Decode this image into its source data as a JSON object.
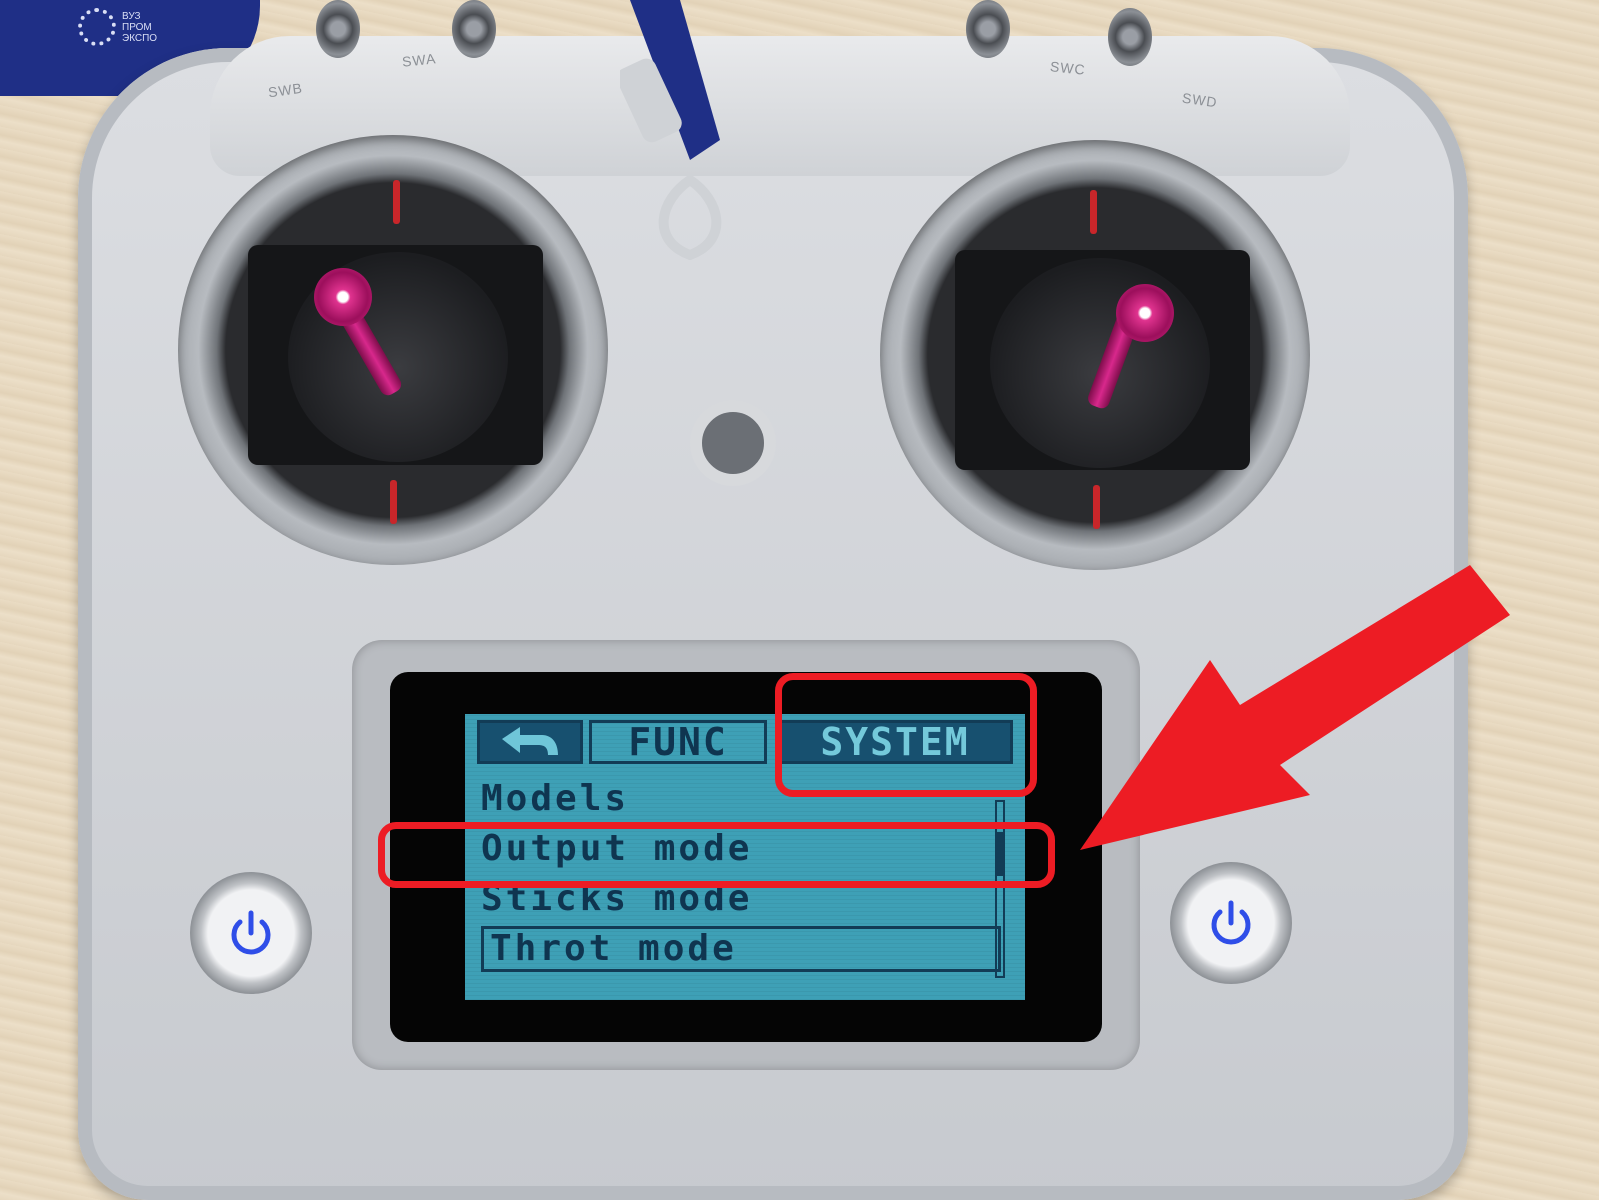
{
  "logo": {
    "lines": "ВУЗ\nПРОМ\nЭКСПО"
  },
  "switches": {
    "labels": [
      "SWB",
      "SWA",
      "SWC",
      "SWD"
    ]
  },
  "screen": {
    "tabs": {
      "back_icon": "back-arrow-icon",
      "func": "FUNC",
      "system": "SYSTEM"
    },
    "menu_items": [
      "Models",
      "Output mode",
      "Sticks mode",
      "Throt mode"
    ]
  },
  "colors": {
    "lcd_background": "#3ea0b6",
    "lcd_text": "#0f3550",
    "highlight": "#ed1c24",
    "power_icon": "#2f4ee8",
    "stick": "#d8288c"
  }
}
